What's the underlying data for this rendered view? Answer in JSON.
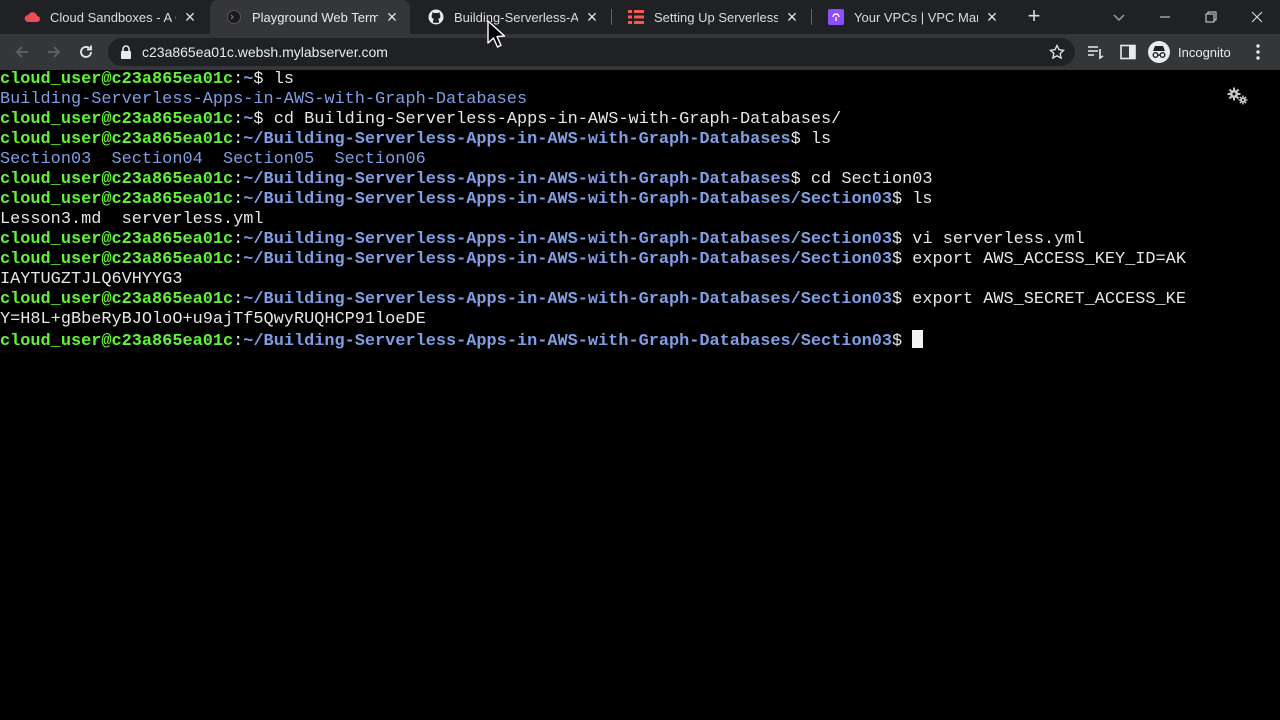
{
  "browser": {
    "tabs": [
      {
        "title": "Cloud Sandboxes - A Cloud Guru",
        "active": false,
        "favicon": "cloud-icon"
      },
      {
        "title": "Playground Web Terminal",
        "active": true,
        "favicon": "terminal-icon"
      },
      {
        "title": "Building-Serverless-Apps-in-AWS-with-Graph-Databases",
        "active": false,
        "favicon": "github-icon"
      },
      {
        "title": "Setting Up Serverless Framework",
        "active": false,
        "favicon": "serverless-icon"
      },
      {
        "title": "Your VPCs | VPC Management Console",
        "active": false,
        "favicon": "vpc-icon"
      }
    ],
    "url": "c23a865ea01c.websh.mylabserver.com",
    "profile_label": "Incognito"
  },
  "terminal": {
    "prompt_user": "cloud_user@c23a865ea01c",
    "lines": [
      {
        "type": "prompt",
        "path": "~",
        "cmd": "ls"
      },
      {
        "type": "dir",
        "text": "Building-Serverless-Apps-in-AWS-with-Graph-Databases"
      },
      {
        "type": "prompt",
        "path": "~",
        "cmd": "cd Building-Serverless-Apps-in-AWS-with-Graph-Databases/"
      },
      {
        "type": "prompt",
        "path": "~/Building-Serverless-Apps-in-AWS-with-Graph-Databases",
        "cmd": "ls"
      },
      {
        "type": "dir",
        "text": "Section03  Section04  Section05  Section06"
      },
      {
        "type": "prompt",
        "path": "~/Building-Serverless-Apps-in-AWS-with-Graph-Databases",
        "cmd": "cd Section03"
      },
      {
        "type": "prompt",
        "path": "~/Building-Serverless-Apps-in-AWS-with-Graph-Databases/Section03",
        "cmd": "ls"
      },
      {
        "type": "output",
        "text": "Lesson3.md  serverless.yml"
      },
      {
        "type": "prompt",
        "path": "~/Building-Serverless-Apps-in-AWS-with-Graph-Databases/Section03",
        "cmd": "vi serverless.yml"
      },
      {
        "type": "prompt",
        "path": "~/Building-Serverless-Apps-in-AWS-with-Graph-Databases/Section03",
        "cmd": "export AWS_ACCESS_KEY_ID=AK"
      },
      {
        "type": "output",
        "text": "IAYTUGZTJLQ6VHYYG3"
      },
      {
        "type": "prompt",
        "path": "~/Building-Serverless-Apps-in-AWS-with-Graph-Databases/Section03",
        "cmd": "export AWS_SECRET_ACCESS_KE"
      },
      {
        "type": "output",
        "text": "Y=H8L+gBbeRyBJOloO+u9ajTf5QwyRUQHCP91loeDE"
      },
      {
        "type": "prompt",
        "path": "~/Building-Serverless-Apps-in-AWS-with-Graph-Databases/Section03",
        "cmd": "",
        "cursor": true
      }
    ]
  },
  "colors": {
    "prompt_user": "#5ff536",
    "prompt_path": "#7f9ee3",
    "terminal_bg": "#000000",
    "tabstrip_bg": "#202124",
    "toolbar_bg": "#35363a"
  }
}
